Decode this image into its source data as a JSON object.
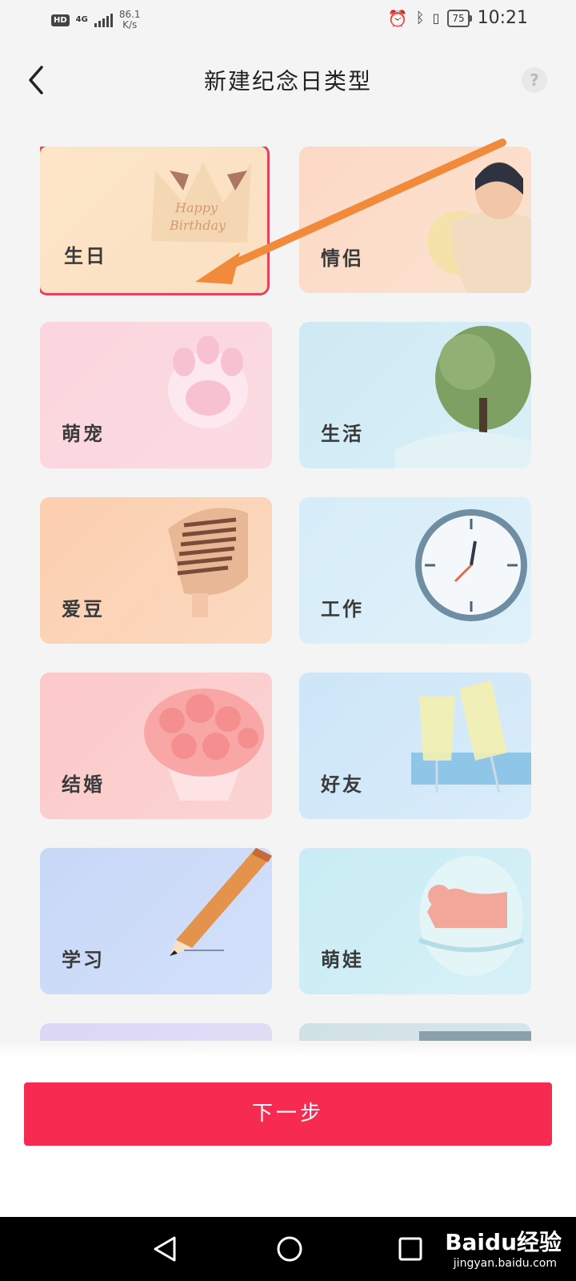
{
  "status_bar": {
    "hd": "HD",
    "network": "4G",
    "speed_value": "86.1",
    "speed_unit": "K/s",
    "battery": "75",
    "time": "10:21"
  },
  "header": {
    "title": "新建纪念日类型",
    "help_symbol": "?"
  },
  "categories": [
    {
      "label": "生日",
      "selected": true
    },
    {
      "label": "情侣"
    },
    {
      "label": "萌宠"
    },
    {
      "label": "生活"
    },
    {
      "label": "爱豆"
    },
    {
      "label": "工作"
    },
    {
      "label": "结婚"
    },
    {
      "label": "好友"
    },
    {
      "label": "学习"
    },
    {
      "label": "萌娃"
    }
  ],
  "birthday_card_text": [
    "Happy",
    "Birthday"
  ],
  "next_button": "下一步",
  "watermark": {
    "brand": "Baidu经验",
    "site": "jingyan.baidu.com"
  },
  "colors": {
    "accent": "#f72a52",
    "selected_border": "#e0445e",
    "annotation_arrow": "#f28a3c"
  }
}
